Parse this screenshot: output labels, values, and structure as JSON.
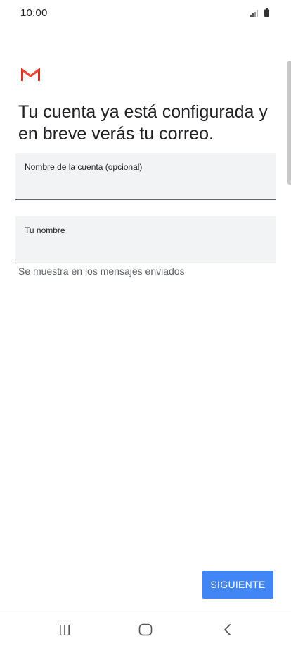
{
  "status_bar": {
    "time": "10:00"
  },
  "icons": {
    "logo": "gmail-logo-icon",
    "signal": "signal-icon",
    "battery": "battery-icon",
    "recent_apps": "recent-apps-icon",
    "home": "home-icon",
    "back": "back-icon"
  },
  "colors": {
    "accent": "#4285f4",
    "gmail_red": "#d93025",
    "field_bg": "#f1f3f4"
  },
  "setup": {
    "heading": "Tu cuenta ya está configurada y en breve verás tu correo.",
    "account_name_field": {
      "label": "Nombre de la cuenta (opcional)",
      "value": ""
    },
    "your_name_field": {
      "label": "Tu nombre",
      "value": ""
    },
    "helper_text": "Se muestra en los mensajes enviados",
    "next_label": "SIGUIENTE"
  }
}
